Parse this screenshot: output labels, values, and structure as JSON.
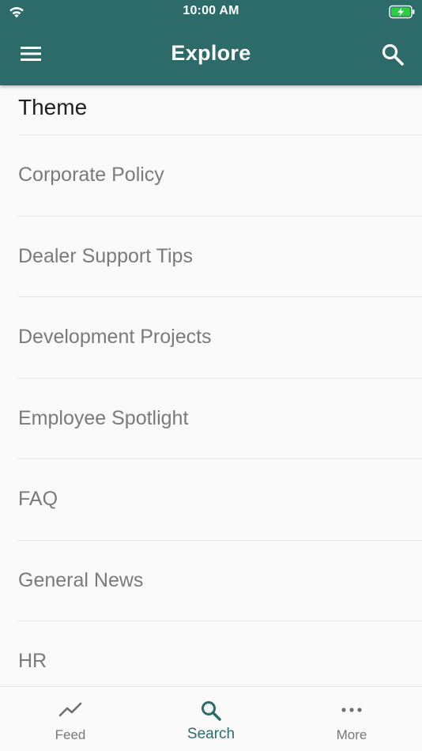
{
  "status_bar": {
    "time": "10:00 AM",
    "wifi_icon": "wifi-icon",
    "battery_icon": "battery-charging-icon",
    "battery_color": "#2ecc40"
  },
  "app_bar": {
    "title": "Explore",
    "menu_icon": "hamburger-menu-icon",
    "search_icon": "search-icon",
    "background_color": "#2c6b6a"
  },
  "content": {
    "section_title": "Theme",
    "items": [
      {
        "label": "Corporate Policy"
      },
      {
        "label": "Dealer Support Tips"
      },
      {
        "label": "Development Projects"
      },
      {
        "label": "Employee Spotlight"
      },
      {
        "label": "FAQ"
      },
      {
        "label": "General News"
      },
      {
        "label": "HR"
      }
    ]
  },
  "tab_bar": {
    "tabs": [
      {
        "label": "Feed",
        "icon": "trending-line-icon",
        "active": false
      },
      {
        "label": "Search",
        "icon": "search-icon",
        "active": true
      },
      {
        "label": "More",
        "icon": "more-dots-icon",
        "active": false
      }
    ],
    "active_color": "#2c6b6a",
    "inactive_color": "#777777"
  }
}
